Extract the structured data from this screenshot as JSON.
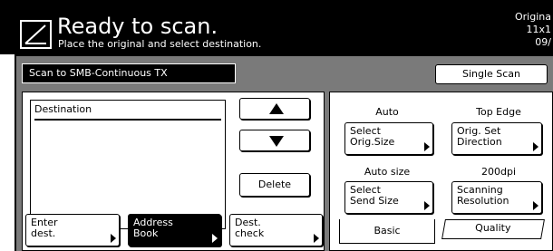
{
  "header": {
    "title": "Ready to scan.",
    "subtitle": "Place the original and select destination.",
    "original_label": "Origina",
    "original_size": "11x1",
    "original_date": "09/"
  },
  "mode_bar": {
    "label": "Scan to SMB-Continuous TX",
    "single_scan": "Single Scan"
  },
  "destination": {
    "label": "Destination",
    "delete": "Delete",
    "enter_dest": [
      "Enter",
      "dest."
    ],
    "address_book": [
      "Address",
      "Book"
    ],
    "dest_check": [
      "Dest.",
      "check"
    ]
  },
  "settings": {
    "orig_size": {
      "value": "Auto",
      "label": [
        "Select",
        "Orig.Size"
      ]
    },
    "orig_direction": {
      "value": "Top Edge",
      "label": [
        "Orig. Set",
        "Direction"
      ]
    },
    "send_size": {
      "value": "Auto size",
      "label": [
        "Select",
        "Send Size"
      ]
    },
    "resolution": {
      "value": "200dpi",
      "label": [
        "Scanning",
        "Resolution"
      ]
    }
  },
  "tabs": {
    "basic": "Basic",
    "quality": "Quality"
  }
}
